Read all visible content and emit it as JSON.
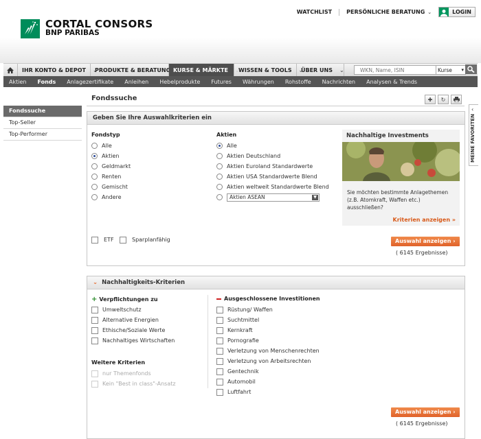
{
  "header": {
    "watchlist": "WATCHLIST",
    "beratung": "PERSÖNLICHE BERATUNG",
    "login": "LOGIN",
    "brand_line1": "CORTAL CONSORS",
    "brand_line2": "BNP PARIBAS"
  },
  "mainnav": {
    "items": [
      {
        "label": "IHR KONTO & DEPOT"
      },
      {
        "label": "PRODUKTE & BERATUNG"
      },
      {
        "label": "KURSE & MÄRKTE"
      },
      {
        "label": "WISSEN & TOOLS"
      },
      {
        "label": "ÜBER UNS"
      }
    ],
    "search_placeholder": "WKN, Name, ISIN",
    "search_type": "Kurse"
  },
  "subnav": {
    "items": [
      "Aktien",
      "Fonds",
      "Anlagezertifikate",
      "Anleihen",
      "Hebelprodukte",
      "Futures",
      "Währungen",
      "Rohstoffe",
      "Nachrichten",
      "Analysen & Trends"
    ]
  },
  "leftnav": {
    "items": [
      "Fondssuche",
      "Top-Seller",
      "Top-Performer"
    ]
  },
  "page": {
    "title": "Fondssuche",
    "favorites_tab": "MEINE FAVORITEN"
  },
  "criteria": {
    "title": "Geben Sie Ihre Auswahlkriterien ein",
    "fondstyp_heading": "Fondstyp",
    "fondstyp": [
      "Alle",
      "Aktien",
      "Geldmarkt",
      "Renten",
      "Gemischt",
      "Andere"
    ],
    "aktien_heading": "Aktien",
    "aktien": [
      "Alle",
      "Aktien Deutschland",
      "Aktien Euroland Standardwerte",
      "Aktien USA Standardwerte Blend",
      "Aktien weltweit Standardwerte Blend"
    ],
    "aktien_select": "Aktien ASEAN",
    "etf": "ETF",
    "sparplan": "Sparplanfähig",
    "button": "Auswahl anzeigen",
    "result": "( 6145 Ergebnisse)"
  },
  "teaser": {
    "title": "Nachhaltige Investments",
    "text": "Sie möchten bestimmte Anlagethemen (z.B. Atomkraft, Waffen etc.) ausschließen?",
    "link": "Kriterien anzeigen"
  },
  "nachhaltig": {
    "title": "Nachhaltigkeits-Kriterien",
    "verpflichtungen_heading": "Verpflichtungen zu",
    "verpflichtungen": [
      "Umweltschutz",
      "Alternative Energien",
      "Ethische/Soziale Werte",
      "Nachhaltiges Wirtschaften"
    ],
    "weitere_heading": "Weitere Kriterien",
    "weitere": [
      "nur Themenfonds",
      "Kein \"Best in class\"-Ansatz"
    ],
    "ausgeschlossen_heading": "Ausgeschlossene Investitionen",
    "ausgeschlossen": [
      "Rüstung/ Waffen",
      "Suchtmittel",
      "Kernkraft",
      "Pornografie",
      "Verletzung von Menschenrechten",
      "Verletzung von Arbeitsrechten",
      "Gentechnik",
      "Automobil",
      "Luftfahrt"
    ],
    "button": "Auswahl anzeigen",
    "result": "( 6145 Ergebnisse)"
  },
  "colors": {
    "brand_green": "#008c5a",
    "accent_orange": "#e66a2c",
    "nav_dark": "#4d4d4d"
  }
}
